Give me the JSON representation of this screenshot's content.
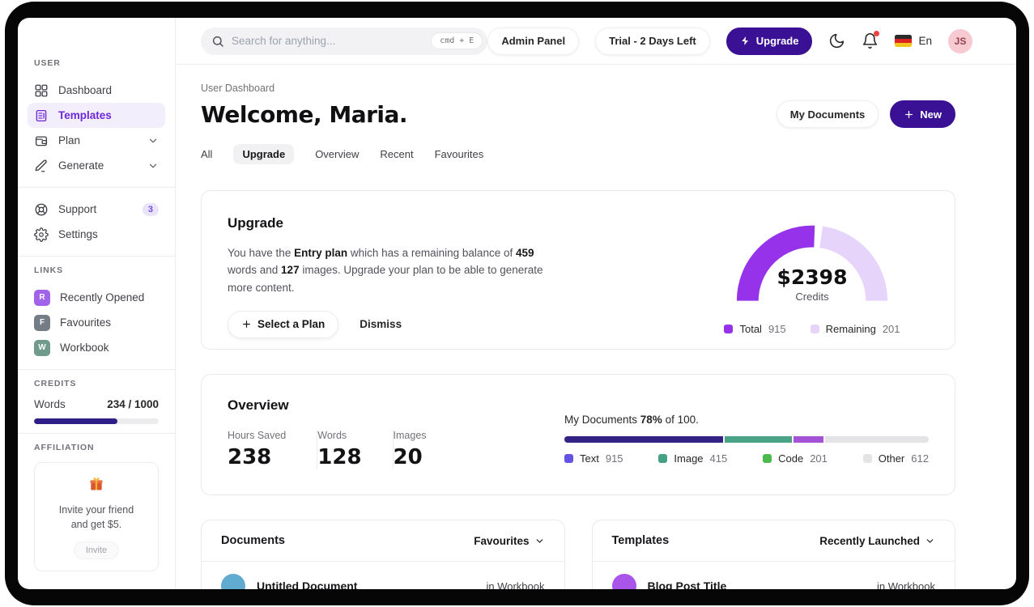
{
  "topbar": {
    "search": {
      "placeholder": "Search for anything...",
      "shortcut": "cmd + E"
    },
    "admin_panel_label": "Admin Panel",
    "trial_label": "Trial - 2 Days Left",
    "upgrade_label": "Upgrade",
    "language_label": "En",
    "avatar_initials": "JS"
  },
  "sidebar": {
    "sections": {
      "user": "USER",
      "links": "LINKS",
      "credits": "CREDITS",
      "affiliation": "AFFILIATION"
    },
    "nav": [
      {
        "label": "Dashboard"
      },
      {
        "label": "Templates"
      },
      {
        "label": "Plan"
      },
      {
        "label": "Generate"
      }
    ],
    "support_label": "Support",
    "support_badge": "3",
    "settings_label": "Settings",
    "links": [
      {
        "initial": "R",
        "label": "Recently Opened",
        "color": "#a163e8"
      },
      {
        "initial": "F",
        "label": "Favourites",
        "color": "#747c86"
      },
      {
        "initial": "W",
        "label": "Workbook",
        "color": "#6f9a8c"
      }
    ],
    "credits": {
      "label": "Words",
      "value": "234 / 1000",
      "fill": "67%",
      "fill_color": "#2e1e87"
    },
    "affiliation": {
      "line1": "Invite your friend",
      "line2": "and get $5.",
      "button_label": "Invite"
    }
  },
  "header": {
    "breadcrumb": "User Dashboard",
    "title": "Welcome, Maria.",
    "my_documents_label": "My Documents",
    "new_label": "New",
    "tabs": [
      {
        "label": "All"
      },
      {
        "label": "Upgrade"
      },
      {
        "label": "Overview"
      },
      {
        "label": "Recent"
      },
      {
        "label": "Favourites"
      }
    ],
    "active_tab": "Upgrade"
  },
  "upgrade_card": {
    "title": "Upgrade",
    "body": {
      "t1": "You have the ",
      "b1": "Entry plan",
      "t2": " which has a remaining balance of ",
      "b2": "459",
      "t3": " words and ",
      "b3": "127",
      "t4": " images. Upgrade your plan to be able to generate more content."
    },
    "select_plan_label": "Select a Plan",
    "dismiss_label": "Dismiss",
    "gauge": {
      "type": "donut",
      "center_value": "$2398",
      "center_label": "Credits",
      "legend": [
        {
          "label": "Total",
          "value": "915",
          "color": "#9633ea"
        },
        {
          "label": "Remaining",
          "value": "201",
          "color": "#e7d4fb"
        }
      ]
    }
  },
  "overview_card": {
    "title": "Overview",
    "stats": [
      {
        "label": "Hours Saved",
        "value": "238"
      },
      {
        "label": "Words",
        "value": "128"
      },
      {
        "label": "Images",
        "value": "20"
      }
    ],
    "progress": {
      "t1": "My Documents ",
      "pct": "78%",
      "t2": " of 100."
    },
    "segments": [
      {
        "label": "Text",
        "width": "43.5%",
        "color": "#342384"
      },
      {
        "label": "Image",
        "width": "19%",
        "color": "#4aa287"
      },
      {
        "label": "Code",
        "width": "8.5%",
        "color": "#a553d6"
      },
      {
        "label": "Other",
        "width": "29%",
        "color": "#e4e4e7"
      }
    ],
    "legend": [
      {
        "label": "Text",
        "value": "915",
        "color": "#6452e5"
      },
      {
        "label": "Image",
        "value": "415",
        "color": "#45a183"
      },
      {
        "label": "Code",
        "value": "201",
        "color": "#4cb94e"
      },
      {
        "label": "Other",
        "value": "612",
        "color": "#e4e4e7"
      }
    ]
  },
  "documents_card": {
    "title": "Documents",
    "filter_label": "Favourites",
    "rows": [
      {
        "title": "Untitled Document",
        "location": "in Workbook",
        "avatar_color": "#62abd0"
      }
    ]
  },
  "templates_card": {
    "title": "Templates",
    "filter_label": "Recently Launched",
    "rows": [
      {
        "title": "Blog Post Title",
        "location": "in Workbook",
        "avatar_color": "#a955e9"
      }
    ]
  }
}
